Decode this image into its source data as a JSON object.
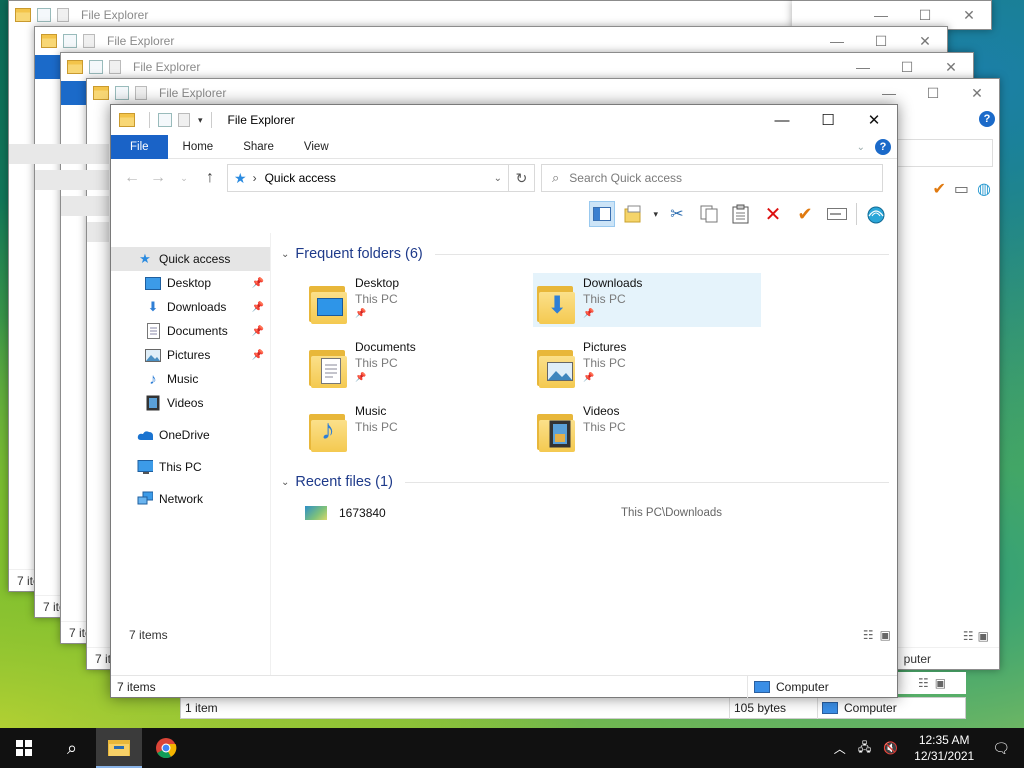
{
  "app_title": "File Explorer",
  "background_windows": {
    "title": "File Explorer",
    "status_items": "7 items",
    "status_items_short": "7 ite",
    "one_item": "1 item",
    "bytes": "105 bytes",
    "computer": "Computer",
    "computer_short": "puter"
  },
  "ribbon": {
    "tabs": [
      "File",
      "Home",
      "Share",
      "View"
    ]
  },
  "nav": {
    "address_path": "Quick access",
    "search_placeholder": "Search Quick access"
  },
  "sidebar": {
    "items": [
      {
        "label": "Quick access"
      },
      {
        "label": "Desktop"
      },
      {
        "label": "Downloads"
      },
      {
        "label": "Documents"
      },
      {
        "label": "Pictures"
      },
      {
        "label": "Music"
      },
      {
        "label": "Videos"
      },
      {
        "label": "OneDrive"
      },
      {
        "label": "This PC"
      },
      {
        "label": "Network"
      }
    ]
  },
  "content": {
    "frequent_header": "Frequent folders (6)",
    "folders": [
      {
        "name": "Desktop",
        "location": "This PC"
      },
      {
        "name": "Downloads",
        "location": "This PC"
      },
      {
        "name": "Documents",
        "location": "This PC"
      },
      {
        "name": "Pictures",
        "location": "This PC"
      },
      {
        "name": "Music",
        "location": "This PC"
      },
      {
        "name": "Videos",
        "location": "This PC"
      }
    ],
    "recent_header": "Recent files (1)",
    "recent_files": [
      {
        "name": "1673840",
        "path": "This PC\\Downloads"
      }
    ],
    "inner_status": "7 items"
  },
  "statusbar": {
    "items": "7 items",
    "computer": "Computer"
  },
  "taskbar": {
    "time": "12:35 AM",
    "date": "12/31/2021"
  },
  "colors": {
    "accent": "#1a63c7",
    "selection": "#e5f3fb"
  }
}
